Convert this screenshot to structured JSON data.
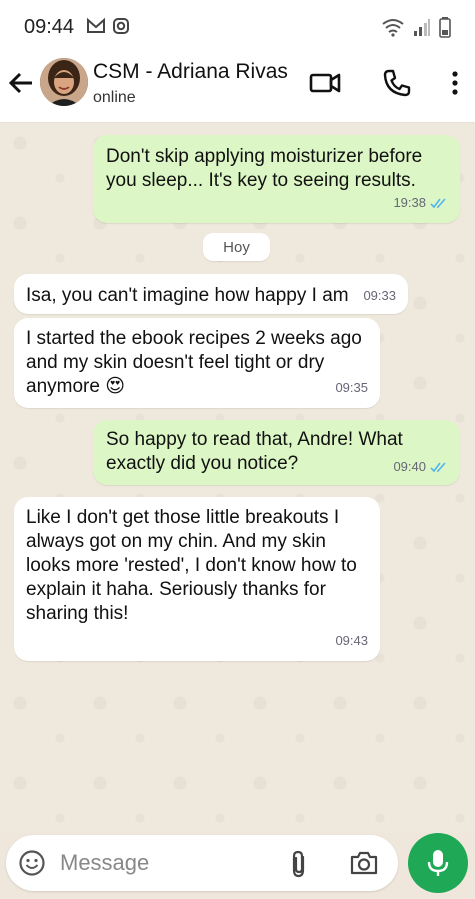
{
  "status_bar": {
    "time": "09:44"
  },
  "header": {
    "contact_name": "CSM - Adriana Rivas",
    "contact_status": "online"
  },
  "chat": {
    "date_separator": "Hoy",
    "messages": [
      {
        "direction": "out",
        "text": "Don't skip applying moisturizer before\nyou sleep... It's key to seeing results.",
        "time": "19:38",
        "read": true
      },
      {
        "direction": "in",
        "text": "Isa, you can't imagine how happy I am",
        "time": "09:33"
      },
      {
        "direction": "in",
        "text": "I started the ebook recipes 2 weeks ago\nand my skin doesn't feel tight or dry\nanymore 😍",
        "time": "09:35"
      },
      {
        "direction": "out",
        "text": "So happy to read that, Andre! What\nexactly did you notice?",
        "time": "09:40",
        "read": true
      },
      {
        "direction": "in",
        "text": "Like I don't get those little breakouts I\nalways got on my chin. And my skin\nlooks more 'rested', I don't know how to\nexplain it haha. Seriously thanks for\nsharing this!",
        "time": "09:43"
      }
    ]
  },
  "composer": {
    "placeholder": "Message"
  },
  "colors": {
    "outgoing_bubble": "#dcf7c5",
    "incoming_bubble": "#ffffff",
    "accent": "#1fa855",
    "read_ticks": "#4fb6ec"
  }
}
